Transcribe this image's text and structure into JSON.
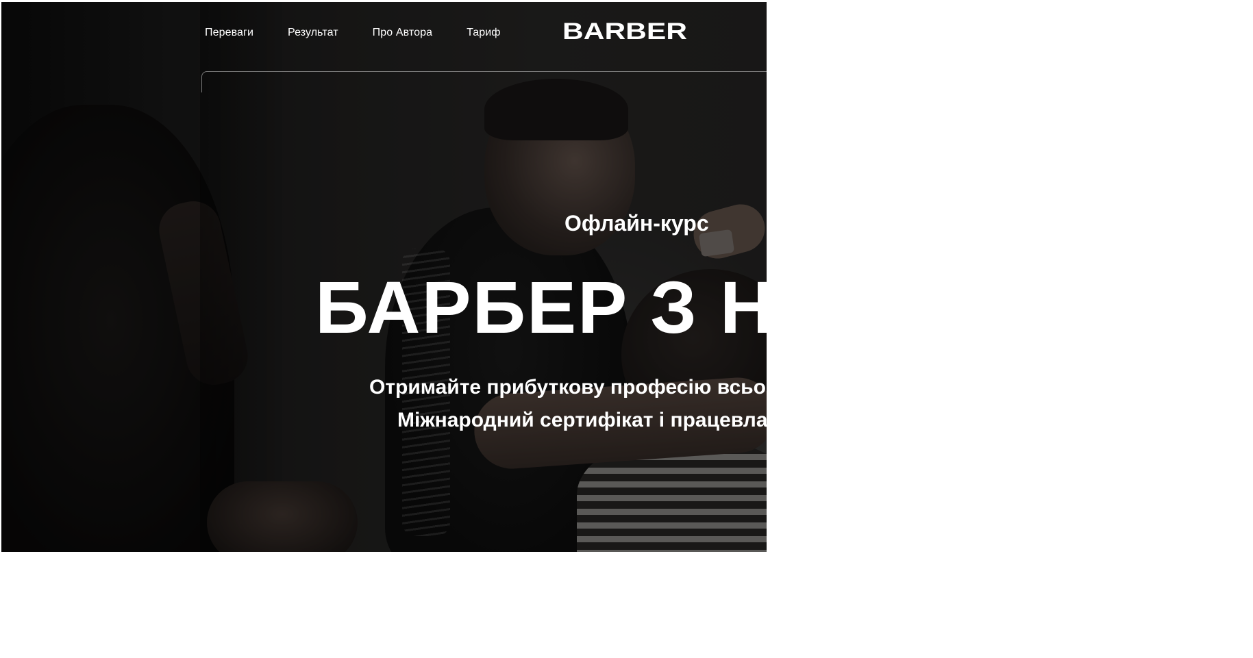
{
  "nav": {
    "items": [
      {
        "label": "Переваги"
      },
      {
        "label": "Результат"
      },
      {
        "label": "Про Автора"
      },
      {
        "label": "Тариф"
      }
    ]
  },
  "logo": {
    "text": "BARBER",
    "icon": "barber-logo"
  },
  "hero": {
    "subtitle": "Офлайн-курс",
    "title": "БАРБЕР З Н",
    "line1": "Отримайте прибуткову професію всьо",
    "line2": "Міжнародний сертифікат і працевла"
  },
  "colors": {
    "text": "#ffffff",
    "background": "#141414",
    "page": "#ffffff"
  }
}
